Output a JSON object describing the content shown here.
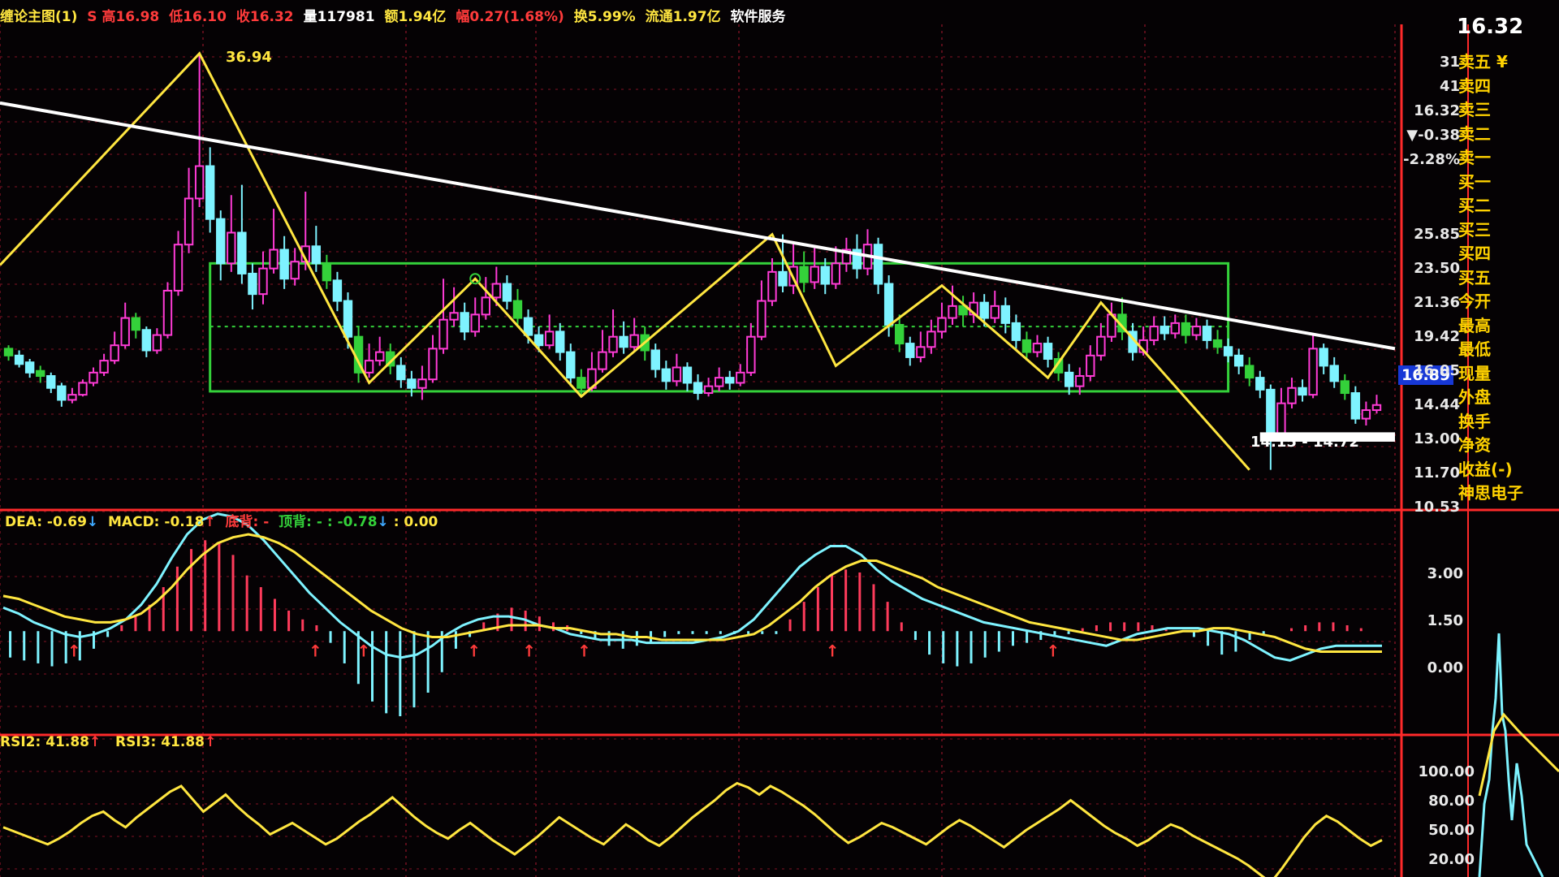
{
  "header": {
    "title": "缠论主图(1)",
    "open": "S 高16.98",
    "low": "低16.10",
    "close": "收16.32",
    "volume": "量117981",
    "amount": "额1.94亿",
    "change": "幅0.27(1.68%)",
    "turnover": "换5.99%",
    "float": "流通1.97亿",
    "sector": "软件服务"
  },
  "colors": {
    "bg": "#050204",
    "grid": "#5a0d1a",
    "up": "#ff3bd6",
    "down": "#7ef3ff",
    "green": "#34d13a",
    "yellow": "#ffe640",
    "white": "#ffffff",
    "red": "#ff2a2a"
  },
  "main_chart": {
    "peak_label": "36.94",
    "range_label": "14.15 - 14.72",
    "current_price_tag": "16.89",
    "scale": [
      "25.85",
      "23.50",
      "21.36",
      "19.42",
      "16.05",
      "14.44",
      "13.00",
      "11.70",
      "10.53"
    ],
    "right_top": [
      "31",
      "41",
      "16.32",
      "▼-0.38",
      "-2.28%"
    ]
  },
  "macd_panel": {
    "dea": "DEA: -0.69",
    "macd": "MACD: -0.18",
    "bottom_div": "底背: -",
    "top_div": "顶背: - : -0.78",
    "extra": ": 0.00",
    "scale": [
      "3.00",
      "1.50",
      "0.00"
    ]
  },
  "rsi_panel": {
    "rsi2": "RSI2: 41.88",
    "rsi3": "RSI3: 41.88",
    "scale": [
      "100.00",
      "80.00",
      "50.00",
      "20.00"
    ]
  },
  "quote_panel": {
    "last_price": "16.32",
    "items": [
      "卖五 ¥",
      "卖四",
      "卖三",
      "卖二",
      "卖一",
      "买一",
      "买二",
      "买三",
      "买四",
      "买五",
      "今开",
      "最高",
      "最低",
      "现量",
      "外盘",
      "换手",
      "净资",
      "收益(-)",
      "神思电子"
    ]
  },
  "chart_data": {
    "type": "candlestick",
    "candles": [
      [
        19.6,
        19.2,
        19.8,
        18.9
      ],
      [
        19.2,
        18.7,
        19.5,
        18.5
      ],
      [
        18.8,
        18.2,
        19.0,
        17.9
      ],
      [
        18.3,
        18.0,
        18.6,
        17.6
      ],
      [
        18.0,
        17.3,
        18.2,
        17.0
      ],
      [
        17.4,
        16.6,
        17.6,
        16.2
      ],
      [
        16.6,
        16.9,
        17.3,
        16.4
      ],
      [
        16.9,
        17.6,
        17.8,
        16.8
      ],
      [
        17.6,
        18.2,
        18.5,
        17.4
      ],
      [
        18.2,
        18.9,
        19.3,
        18.0
      ],
      [
        18.9,
        19.8,
        20.6,
        18.7
      ],
      [
        19.8,
        21.4,
        22.3,
        19.6
      ],
      [
        21.4,
        20.7,
        21.7,
        20.2
      ],
      [
        20.7,
        19.5,
        20.9,
        19.1
      ],
      [
        19.5,
        20.4,
        20.8,
        19.3
      ],
      [
        20.4,
        23.0,
        23.5,
        20.2
      ],
      [
        23.0,
        25.7,
        26.5,
        22.7
      ],
      [
        25.7,
        28.4,
        30.2,
        25.2
      ],
      [
        28.4,
        30.3,
        36.9,
        27.9
      ],
      [
        30.3,
        27.2,
        31.4,
        26.4
      ],
      [
        27.2,
        24.6,
        27.7,
        23.6
      ],
      [
        24.6,
        26.4,
        28.6,
        24.1
      ],
      [
        26.4,
        24.0,
        29.2,
        23.4
      ],
      [
        24.0,
        22.8,
        24.6,
        21.9
      ],
      [
        22.8,
        24.3,
        25.3,
        22.2
      ],
      [
        24.3,
        25.4,
        27.8,
        24.0
      ],
      [
        25.4,
        23.7,
        26.2,
        23.1
      ],
      [
        23.7,
        24.7,
        25.5,
        23.3
      ],
      [
        24.7,
        25.6,
        28.8,
        24.2
      ],
      [
        25.6,
        24.6,
        26.8,
        24.1
      ],
      [
        24.6,
        23.6,
        25.1,
        23.1
      ],
      [
        23.6,
        22.4,
        24.1,
        21.8
      ],
      [
        22.4,
        20.3,
        22.9,
        19.6
      ],
      [
        20.3,
        18.2,
        20.9,
        17.6
      ],
      [
        18.2,
        18.9,
        19.9,
        17.9
      ],
      [
        18.9,
        19.4,
        20.3,
        18.6
      ],
      [
        19.4,
        18.6,
        19.9,
        18.1
      ],
      [
        18.6,
        17.8,
        19.1,
        17.3
      ],
      [
        17.8,
        17.3,
        18.3,
        16.8
      ],
      [
        17.3,
        17.8,
        18.6,
        16.6
      ],
      [
        17.8,
        19.6,
        20.4,
        17.6
      ],
      [
        19.6,
        21.3,
        23.7,
        19.3
      ],
      [
        21.3,
        21.7,
        23.2,
        20.9
      ],
      [
        21.7,
        20.6,
        22.3,
        20.1
      ],
      [
        20.6,
        21.6,
        22.6,
        20.3
      ],
      [
        21.6,
        22.6,
        23.8,
        21.3
      ],
      [
        22.6,
        23.4,
        24.4,
        22.1
      ],
      [
        23.4,
        22.4,
        23.9,
        21.9
      ],
      [
        22.4,
        21.4,
        23.1,
        20.9
      ],
      [
        21.4,
        20.4,
        21.9,
        19.9
      ],
      [
        20.4,
        19.8,
        20.9,
        19.4
      ],
      [
        19.8,
        20.6,
        21.6,
        19.6
      ],
      [
        20.6,
        19.4,
        21.1,
        18.9
      ],
      [
        19.4,
        17.9,
        19.9,
        17.4
      ],
      [
        17.9,
        17.3,
        18.4,
        16.8
      ],
      [
        17.3,
        18.4,
        19.4,
        17.1
      ],
      [
        18.4,
        19.4,
        20.7,
        18.2
      ],
      [
        19.4,
        20.3,
        21.9,
        19.1
      ],
      [
        20.3,
        19.7,
        21.2,
        19.3
      ],
      [
        19.7,
        20.4,
        21.4,
        19.4
      ],
      [
        20.4,
        19.5,
        20.9,
        18.9
      ],
      [
        19.5,
        18.4,
        19.9,
        17.9
      ],
      [
        18.4,
        17.7,
        18.9,
        17.2
      ],
      [
        17.7,
        18.5,
        19.3,
        17.4
      ],
      [
        18.5,
        17.6,
        18.8,
        17.1
      ],
      [
        17.6,
        17.0,
        18.1,
        16.6
      ],
      [
        17.0,
        17.4,
        17.9,
        16.8
      ],
      [
        17.4,
        17.9,
        18.5,
        17.1
      ],
      [
        17.9,
        17.6,
        18.3,
        17.2
      ],
      [
        17.6,
        18.2,
        18.7,
        17.4
      ],
      [
        18.2,
        20.3,
        21.1,
        18.0
      ],
      [
        20.3,
        22.4,
        23.6,
        20.1
      ],
      [
        22.4,
        24.1,
        24.9,
        22.1
      ],
      [
        24.1,
        23.3,
        26.3,
        22.9
      ],
      [
        23.3,
        24.4,
        25.8,
        22.8
      ],
      [
        24.4,
        23.5,
        25.3,
        22.9
      ],
      [
        23.5,
        24.4,
        25.5,
        23.1
      ],
      [
        24.4,
        23.4,
        24.9,
        22.8
      ],
      [
        23.4,
        24.6,
        25.6,
        23.1
      ],
      [
        24.6,
        25.4,
        26.1,
        24.1
      ],
      [
        25.4,
        24.3,
        26.3,
        23.7
      ],
      [
        24.3,
        25.7,
        26.6,
        23.9
      ],
      [
        25.7,
        23.4,
        26.1,
        22.8
      ],
      [
        23.4,
        21.0,
        23.9,
        20.3
      ],
      [
        21.0,
        19.9,
        21.6,
        19.4
      ],
      [
        19.9,
        19.1,
        20.3,
        18.6
      ],
      [
        19.1,
        19.7,
        20.6,
        18.8
      ],
      [
        19.7,
        20.6,
        21.3,
        19.3
      ],
      [
        20.6,
        21.4,
        22.3,
        20.2
      ],
      [
        21.4,
        22.1,
        23.3,
        21.0
      ],
      [
        22.1,
        21.6,
        22.7,
        20.9
      ],
      [
        21.6,
        22.3,
        22.9,
        21.1
      ],
      [
        22.3,
        21.4,
        22.8,
        20.9
      ],
      [
        21.4,
        22.1,
        23.0,
        21.1
      ],
      [
        22.1,
        21.1,
        22.6,
        20.5
      ],
      [
        21.1,
        20.1,
        21.6,
        19.6
      ],
      [
        20.1,
        19.4,
        20.6,
        18.9
      ],
      [
        19.4,
        19.9,
        20.4,
        19.1
      ],
      [
        19.9,
        19.0,
        20.3,
        18.5
      ],
      [
        19.0,
        18.2,
        19.4,
        17.7
      ],
      [
        18.2,
        17.4,
        18.7,
        16.9
      ],
      [
        17.4,
        18.0,
        18.5,
        16.9
      ],
      [
        18.0,
        19.2,
        19.8,
        17.7
      ],
      [
        19.2,
        20.3,
        21.1,
        18.9
      ],
      [
        20.3,
        21.6,
        22.3,
        20.0
      ],
      [
        21.6,
        20.6,
        22.6,
        20.1
      ],
      [
        20.6,
        19.4,
        21.1,
        18.9
      ],
      [
        19.4,
        20.1,
        20.9,
        19.2
      ],
      [
        20.1,
        20.9,
        21.5,
        19.8
      ],
      [
        20.9,
        20.5,
        21.5,
        20.1
      ],
      [
        20.5,
        21.1,
        21.6,
        20.2
      ],
      [
        21.1,
        20.4,
        21.6,
        19.9
      ],
      [
        20.4,
        20.9,
        21.4,
        20.1
      ],
      [
        20.9,
        20.1,
        21.3,
        19.6
      ],
      [
        20.1,
        19.7,
        20.7,
        19.3
      ],
      [
        19.7,
        19.2,
        20.2,
        18.8
      ],
      [
        19.2,
        18.6,
        19.6,
        18.1
      ],
      [
        18.6,
        17.9,
        19.1,
        17.4
      ],
      [
        17.9,
        17.2,
        18.3,
        16.7
      ],
      [
        17.2,
        14.6,
        17.5,
        12.5
      ],
      [
        14.6,
        16.4,
        17.3,
        14.4
      ],
      [
        16.4,
        17.3,
        17.9,
        16.1
      ],
      [
        17.3,
        16.9,
        17.8,
        16.5
      ],
      [
        16.9,
        19.6,
        20.4,
        16.7
      ],
      [
        19.6,
        18.6,
        19.9,
        18.1
      ],
      [
        18.6,
        17.7,
        19.1,
        17.3
      ],
      [
        17.7,
        17.0,
        18.1,
        16.6
      ],
      [
        17.0,
        15.5,
        17.4,
        15.2
      ],
      [
        15.5,
        16.0,
        16.5,
        15.1
      ],
      [
        16.0,
        16.3,
        16.9,
        15.8
      ]
    ],
    "price_range": [
      10.53,
      36.94
    ],
    "macd": {
      "hist": [
        -0.9,
        -1.0,
        -1.1,
        -1.2,
        -1.1,
        -1.0,
        -0.6,
        -0.2,
        0.2,
        0.5,
        0.9,
        1.5,
        2.2,
        2.8,
        3.1,
        3.0,
        2.6,
        1.9,
        1.5,
        1.1,
        0.7,
        0.4,
        0.2,
        -0.4,
        -1.1,
        -1.8,
        -2.4,
        -2.8,
        -2.9,
        -2.6,
        -2.1,
        -1.4,
        -0.6,
        -0.2,
        0.3,
        0.6,
        0.8,
        0.7,
        0.5,
        0.3,
        0.2,
        -0.1,
        -0.3,
        -0.5,
        -0.6,
        -0.5,
        -0.4,
        -0.2,
        -0.1,
        -0.1,
        -0.1,
        -0.1,
        -0.1,
        -0.1,
        -0.1,
        -0.1,
        0.4,
        1.0,
        1.5,
        1.9,
        2.1,
        2.0,
        1.6,
        1.0,
        0.3,
        -0.3,
        -0.8,
        -1.1,
        -1.2,
        -1.1,
        -0.9,
        -0.7,
        -0.5,
        -0.4,
        -0.3,
        -0.2,
        -0.1,
        0.1,
        0.2,
        0.3,
        0.3,
        0.3,
        0.2,
        0.1,
        0.0,
        -0.2,
        -0.5,
        -0.8,
        -0.7,
        -0.3,
        -0.1,
        0.0,
        0.1,
        0.2,
        0.3,
        0.3,
        0.2,
        0.1,
        0.0
      ],
      "dif": [
        0.8,
        0.6,
        0.3,
        0.1,
        -0.1,
        -0.2,
        -0.1,
        0.1,
        0.4,
        0.9,
        1.6,
        2.5,
        3.3,
        3.8,
        4.0,
        3.9,
        3.6,
        3.1,
        2.5,
        1.9,
        1.3,
        0.8,
        0.3,
        -0.1,
        -0.5,
        -0.8,
        -0.9,
        -0.8,
        -0.5,
        -0.1,
        0.2,
        0.4,
        0.5,
        0.5,
        0.4,
        0.2,
        0.1,
        -0.1,
        -0.2,
        -0.3,
        -0.3,
        -0.3,
        -0.4,
        -0.4,
        -0.4,
        -0.4,
        -0.3,
        -0.2,
        0.0,
        0.4,
        1.0,
        1.6,
        2.2,
        2.6,
        2.9,
        2.9,
        2.6,
        2.1,
        1.7,
        1.4,
        1.1,
        0.9,
        0.7,
        0.5,
        0.3,
        0.2,
        0.1,
        0.0,
        -0.1,
        -0.2,
        -0.3,
        -0.4,
        -0.5,
        -0.3,
        -0.1,
        0.0,
        0.1,
        0.1,
        0.1,
        0.0,
        -0.1,
        -0.3,
        -0.6,
        -0.9,
        -1.0,
        -0.8,
        -0.6,
        -0.5,
        -0.5,
        -0.5,
        -0.5
      ],
      "dea": [
        1.2,
        1.1,
        0.9,
        0.7,
        0.5,
        0.4,
        0.3,
        0.3,
        0.4,
        0.6,
        1.0,
        1.5,
        2.1,
        2.6,
        3.0,
        3.2,
        3.3,
        3.2,
        3.0,
        2.7,
        2.3,
        1.9,
        1.5,
        1.1,
        0.7,
        0.4,
        0.1,
        -0.1,
        -0.2,
        -0.2,
        -0.1,
        0.0,
        0.1,
        0.2,
        0.2,
        0.2,
        0.1,
        0.1,
        0.0,
        -0.1,
        -0.1,
        -0.2,
        -0.2,
        -0.3,
        -0.3,
        -0.3,
        -0.3,
        -0.3,
        -0.2,
        -0.1,
        0.2,
        0.6,
        1.0,
        1.5,
        1.9,
        2.2,
        2.4,
        2.4,
        2.2,
        2.0,
        1.8,
        1.5,
        1.3,
        1.1,
        0.9,
        0.7,
        0.5,
        0.3,
        0.2,
        0.1,
        0.0,
        -0.1,
        -0.2,
        -0.3,
        -0.3,
        -0.2,
        -0.1,
        0.0,
        0.0,
        0.1,
        0.1,
        0.0,
        -0.1,
        -0.2,
        -0.4,
        -0.6,
        -0.7,
        -0.7,
        -0.7,
        -0.7,
        -0.7
      ],
      "range": [
        -3.4,
        3.8
      ]
    },
    "rsi": {
      "values": [
        55,
        52,
        49,
        46,
        43,
        47,
        52,
        58,
        63,
        66,
        60,
        55,
        62,
        68,
        74,
        80,
        84,
        75,
        66,
        72,
        78,
        70,
        63,
        57,
        50,
        54,
        58,
        53,
        48,
        43,
        47,
        53,
        59,
        64,
        70,
        76,
        69,
        62,
        56,
        51,
        47,
        53,
        58,
        52,
        46,
        41,
        36,
        42,
        48,
        55,
        62,
        57,
        52,
        47,
        43,
        50,
        57,
        52,
        46,
        42,
        48,
        55,
        62,
        68,
        74,
        81,
        86,
        83,
        78,
        84,
        80,
        75,
        70,
        64,
        57,
        50,
        44,
        48,
        53,
        58,
        55,
        51,
        47,
        43,
        49,
        55,
        60,
        56,
        51,
        46,
        41,
        47,
        53,
        58,
        63,
        68,
        74,
        68,
        62,
        56,
        51,
        47,
        42,
        46,
        52,
        57,
        54,
        49,
        45,
        41,
        37,
        33,
        28,
        22,
        16,
        26,
        37,
        48,
        57,
        63,
        59,
        53,
        47,
        42,
        46
      ],
      "range": [
        20,
        100
      ]
    }
  }
}
